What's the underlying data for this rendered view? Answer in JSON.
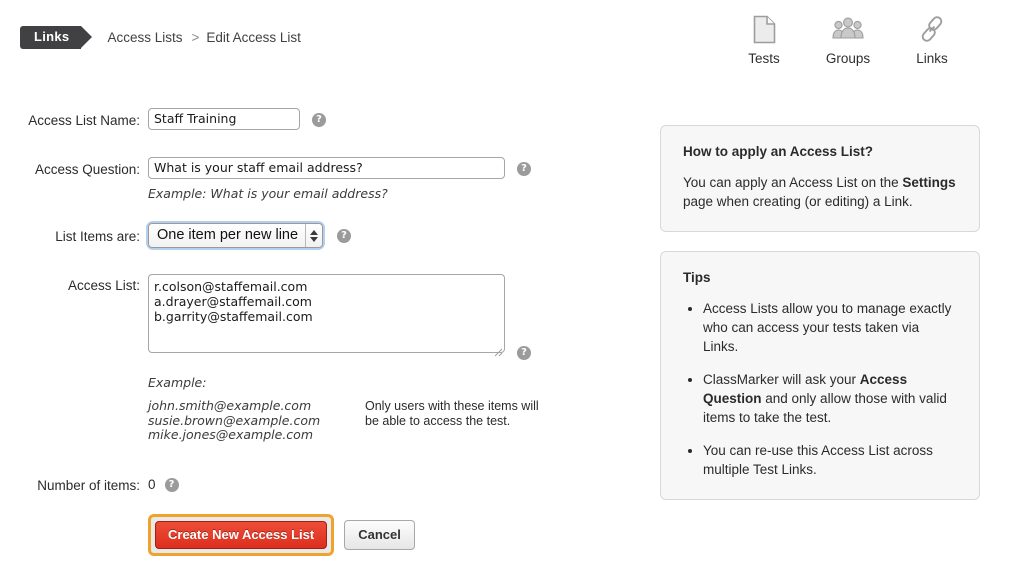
{
  "breadcrumb": {
    "tag": "Links",
    "parent": "Access Lists",
    "separator": ">",
    "current": "Edit Access List"
  },
  "topnav": {
    "items": [
      {
        "label": "Tests",
        "icon": "document-icon"
      },
      {
        "label": "Groups",
        "icon": "group-icon"
      },
      {
        "label": "Links",
        "icon": "chain-link-icon"
      }
    ]
  },
  "form": {
    "name": {
      "label": "Access List Name:",
      "value": "Staff Training",
      "placeholder": ""
    },
    "question": {
      "label": "Access Question:",
      "value": "What is your staff email address?",
      "placeholder": "",
      "hint": "Example: What is your email address?"
    },
    "list_items_are": {
      "label": "List Items are:",
      "value": "One item per new line",
      "options": [
        "One item per new line"
      ]
    },
    "access_list": {
      "label": "Access List:",
      "value": "r.colson@staffemail.com\na.drayer@staffemail.com\nb.garrity@staffemail.com",
      "placeholder": "",
      "example_label": "Example:",
      "example_items": "john.smith@example.com\nsusie.brown@example.com\nmike.jones@example.com",
      "note": "Only users with these items will be able to access the test."
    },
    "number_of_items": {
      "label": "Number of items:",
      "value": "0"
    },
    "help_glyph": "?",
    "submit_label": "Create New Access List",
    "cancel_label": "Cancel"
  },
  "panels": [
    {
      "title": "How to apply an Access List?",
      "body_before": "You can apply an Access List on the ",
      "body_bold": "Settings",
      "body_after": " page when creating (or editing) a Link.",
      "bullets": []
    },
    {
      "title": "Tips",
      "bullets": [
        {
          "before": "Access Lists allow you to manage exactly who can access your tests taken via Links.",
          "bold": "",
          "after": ""
        },
        {
          "before": "ClassMarker will ask your ",
          "bold": "Access Question",
          "after": " and only allow those with valid items to take the test."
        },
        {
          "before": "You can re-use this Access List across multiple Test Links.",
          "bold": "",
          "after": ""
        }
      ]
    }
  ],
  "colors": {
    "tag_bg": "#414042",
    "primary_button": "#dd2f1d",
    "focus_ring": "#f0a32c",
    "panel_bg": "#f7f7f7"
  }
}
